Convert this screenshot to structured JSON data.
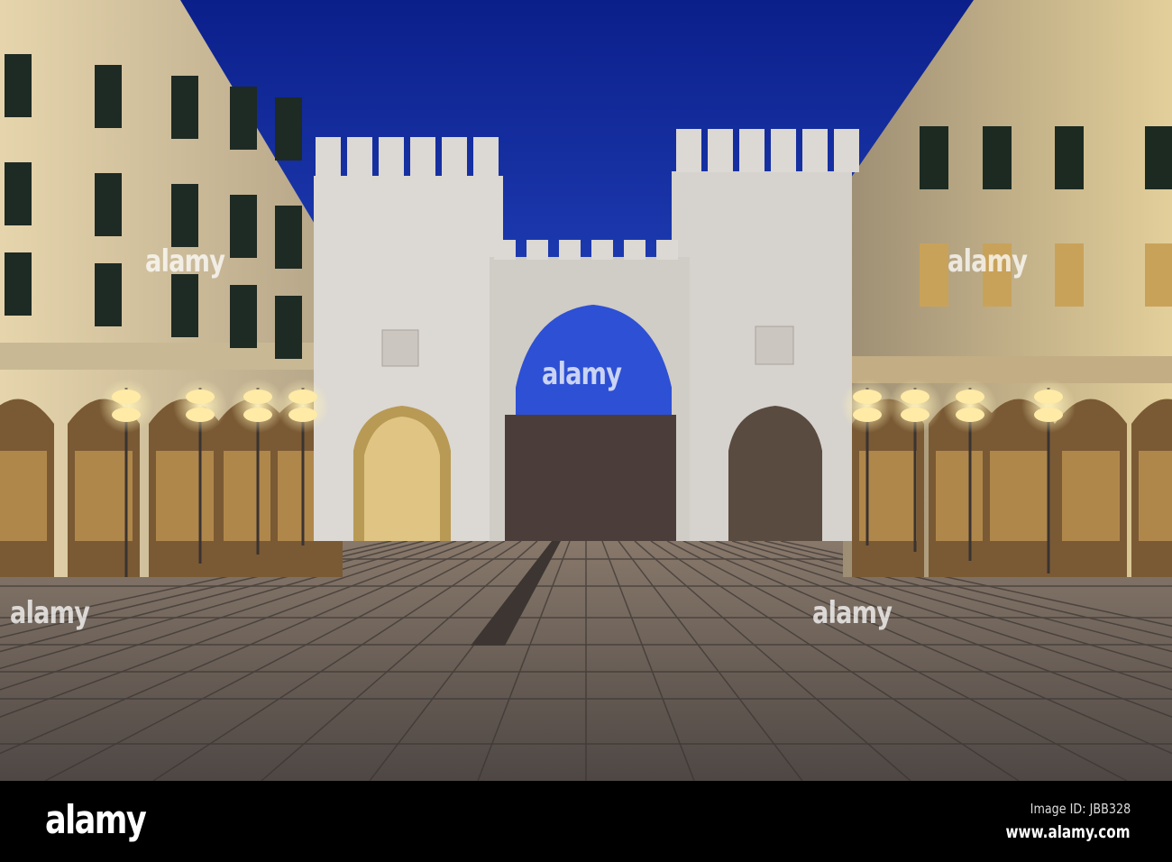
{
  "photo": {
    "subject": "Karlstor gate at dusk",
    "colors": {
      "sky_top": "#0b1f8a",
      "sky_bottom": "#2b4fd0",
      "stone": "#d9d6d2",
      "building": "#d8c9a6",
      "pavement": "#6b6058",
      "lamp": "#ffe9a8"
    }
  },
  "watermark": {
    "text": "alamy"
  },
  "footer": {
    "logo": "alamy",
    "image_id": "Image ID: JBB328",
    "website": "www.alamy.com"
  }
}
